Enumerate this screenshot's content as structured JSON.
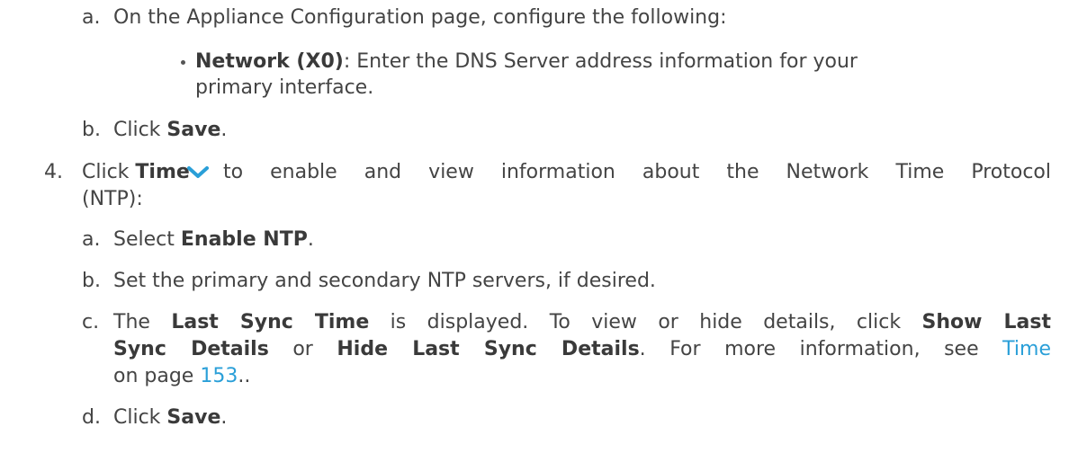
{
  "step3": {
    "a": {
      "marker": "a.",
      "text": "On the Appliance Configuration page, configure the following:",
      "bullet": {
        "bold": "Network (X0)",
        "text_line1": ": Enter the DNS Server address information for your",
        "text_line2": "primary interface."
      }
    },
    "b": {
      "marker": "b.",
      "pre": "Click ",
      "bold": "Save",
      "post": "."
    }
  },
  "step4": {
    "marker": "4.",
    "pre": "Click ",
    "bold": "Time",
    "icon": "chevron-down-icon",
    "icon_color": "#2a9fd8",
    "text_line1": "to enable and view information about the Network Time Protocol",
    "text_line2": "(NTP):",
    "a": {
      "marker": "a.",
      "pre": "Select ",
      "bold": "Enable NTP",
      "post": "."
    },
    "b": {
      "marker": "b.",
      "text": "Set the primary and secondary NTP servers, if desired."
    },
    "c": {
      "marker": "c.",
      "pre": "The ",
      "bold1": "Last Sync Time",
      "mid1": " is displayed. To view or hide details, click ",
      "bold2": "Show Last",
      "bold3": "Sync Details",
      "mid2": " or ",
      "bold4": "Hide Last Sync Details",
      "mid3": ". For more information, see ",
      "link1": "Time",
      "line3_pre": "on page ",
      "link2": "153",
      "line3_post": ".."
    },
    "d": {
      "marker": "d.",
      "pre": "Click ",
      "bold": "Save",
      "post": "."
    }
  }
}
